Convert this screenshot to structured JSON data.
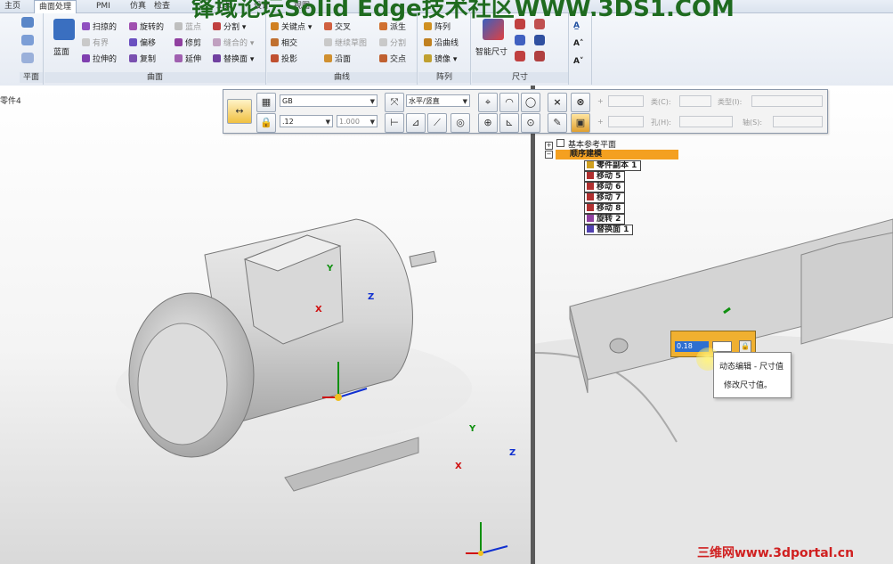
{
  "banner": "锋域论坛Solid Edge技术社区WWW.3DS1.COM",
  "tabs": [
    {
      "label": "主页",
      "active": false
    },
    {
      "label": "曲面处理",
      "active": true
    },
    {
      "label": "PMI",
      "active": false
    },
    {
      "label": "仿真",
      "active": false
    },
    {
      "label": "检查",
      "active": false
    },
    {
      "label": "工具",
      "active": false
    },
    {
      "label": "设计",
      "active": false
    },
    {
      "label": "视图",
      "active": false
    }
  ],
  "ribbon": {
    "groups": {
      "plane": "平面",
      "surface": "曲面",
      "curve": "曲线",
      "array": "阵列",
      "dimension": "尺寸"
    },
    "surface_cmds": {
      "blue_surface": "蓝面",
      "swept": "扫掠的",
      "bounded": "有界",
      "extruded": "拉伸的",
      "revolved": "旋转的",
      "offset": "偏移",
      "copy": "复制",
      "blue_dot": "蓝点",
      "trim": "修剪",
      "extend": "延伸",
      "split": "分割",
      "stitched": "缝合的",
      "replace_face": "替换面"
    },
    "curve_cmds": {
      "keypoint": "关键点",
      "intersect": "相交",
      "project": "投影",
      "cross": "交叉",
      "contour_sketch": "继续草图",
      "along_surface": "沿面",
      "derived": "派生",
      "split": "分割",
      "intersection_point": "交点"
    },
    "array_cmds": {
      "pattern": "阵列",
      "along_curve": "沿曲线",
      "mirror": "镜像"
    },
    "dimension_cmds": {
      "smart_dimension": "智能尺寸"
    }
  },
  "document_tab": "零件4",
  "command_bar": {
    "standard": "GB",
    "orientation": "水平/竖直",
    "font_size": ".12",
    "scale": "1.000",
    "field_labels": {
      "class": "类(C):",
      "type": "类型(I):",
      "hole": "孔(H):",
      "axis": "轴(S):"
    }
  },
  "tree": {
    "base_planes": "基本参考平面",
    "sequential": "顺序建模",
    "features": [
      "零件副本 1",
      "移动 5",
      "移动 6",
      "移动 7",
      "移动 8",
      "旋转 2",
      "替换面 1"
    ]
  },
  "dynamic_edit": {
    "value": "0.18",
    "tooltip_title": "动态编辑 - 尺寸值",
    "tooltip_body": "修改尺寸值。"
  },
  "axes": {
    "x": "X",
    "y": "Y",
    "z": "Z"
  },
  "watermark": "三维网www.3dportal.cn",
  "colors": {
    "banner": "#1f6b1f",
    "sequential_highlight": "#f4a020",
    "watermark": "#d02020",
    "axis_x": "#d01010",
    "axis_y": "#109010",
    "axis_z": "#1030d0"
  }
}
